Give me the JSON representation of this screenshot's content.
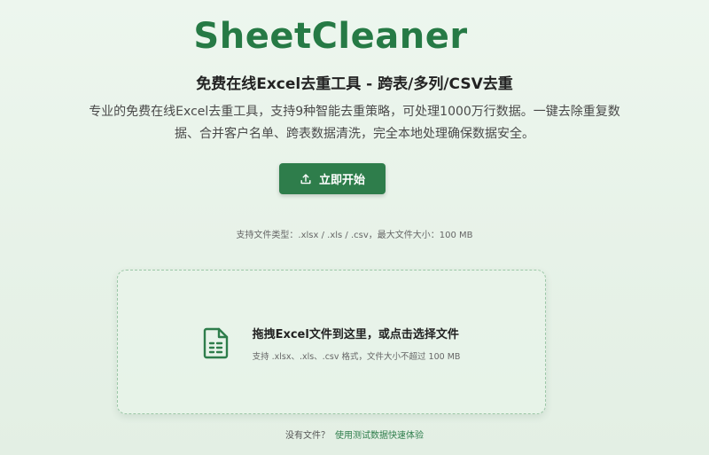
{
  "brand": {
    "name": "SheetCleaner"
  },
  "hero": {
    "subtitle": "免费在线Excel去重工具 - 跨表/多列/CSV去重",
    "description": "专业的免费在线Excel去重工具，支持9种智能去重策略，可处理1000万行数据。一键去除重复数据、合并客户名单、跨表数据清洗，完全本地处理确保数据安全。",
    "start_button_label": "立即开始",
    "start_button_icon": "upload-icon"
  },
  "upload": {
    "file_types_note": "支持文件类型：.xlsx / .xls / .csv，最大文件大小：100 MB",
    "dropzone_icon": "spreadsheet-file-icon",
    "dropzone_title": "拖拽Excel文件到这里，或点击选择文件",
    "dropzone_hint": "支持 .xlsx、.xls、.csv 格式，文件大小不超过 100 MB"
  },
  "footer": {
    "no_file_text": "没有文件？",
    "sample_link_text": "使用测试数据快速体验"
  },
  "colors": {
    "brand_green": "#267a45",
    "button_green": "#2e7d4b",
    "background": "#e9f4ea"
  }
}
